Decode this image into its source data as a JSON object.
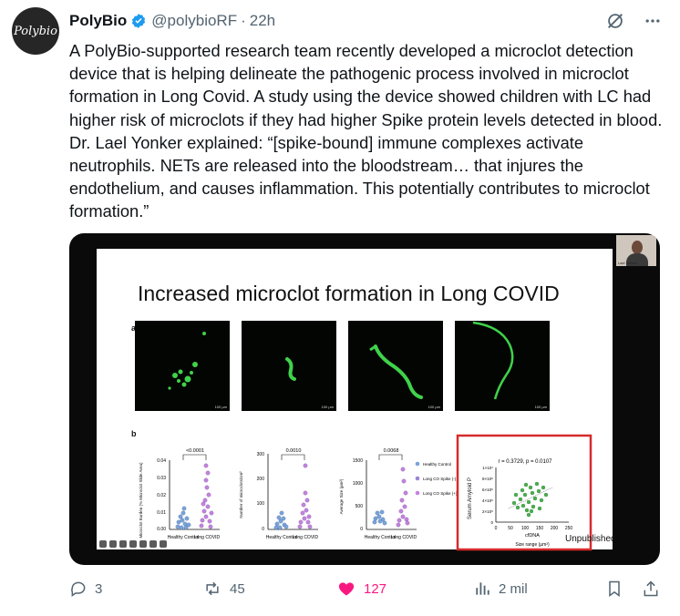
{
  "author": {
    "avatar_text": "Polybio",
    "name": "PolyBio",
    "handle": "@polybioRF",
    "separator": "·",
    "time": "22h"
  },
  "tweet": {
    "text": "A PolyBio-supported research team recently developed a microclot detection device that is helping delineate the pathogenic process involved in microclot formation in Long Covid. A study using the device showed children with LC had higher risk of microclots if they had higher Spike protein levels detected in blood. Dr. Lael Yonker explained: “[spike-bound] immune complexes activate neutrophils. NETs are released into the bloodstream… that injures the endothelium, and causes inflammation. This potentially contributes to microclot formation.”"
  },
  "media": {
    "slide_title": "Increased microclot formation in Long COVID",
    "panel_a": "a",
    "panel_b": "b",
    "scale_bar": "100 µm",
    "unpublished": "Unpublished",
    "presenter_caption": "Lael Yonker",
    "plots": [
      {
        "ylabel": "Microclot Burden (% Microclot Slide Area)",
        "yticks": [
          "0.04",
          "0.03",
          "0.02",
          "0.01",
          "0.00"
        ],
        "pvalue": "<0.0001",
        "x1": "Healthy Control",
        "x2": "Long COVID"
      },
      {
        "ylabel": "Number of microclots/cm²",
        "yticks": [
          "300",
          "200",
          "100",
          "0"
        ],
        "pvalue": "0.0010",
        "x1": "Healthy Control",
        "x2": "Long COVID"
      },
      {
        "ylabel": "Average Size (µm²)",
        "yticks": [
          "1500",
          "1000",
          "500",
          "0"
        ],
        "pvalue": "0.0068",
        "x1": "Healthy Control",
        "x2": "Long COVID"
      }
    ],
    "legend": [
      "Healthy Control",
      "Long CO Spike (-)",
      "Long CO Spike (+)"
    ],
    "scatter": {
      "title": "r = 0.3729, p = 0.0107",
      "ylabel": "Serum Amyloid P",
      "yticks": [
        "1×10⁷",
        "8×10⁶",
        "6×10⁶",
        "4×10⁶",
        "2×10⁶",
        "0"
      ],
      "xticks": [
        "0",
        "50",
        "100",
        "150",
        "200",
        "250"
      ],
      "xlabel": "cfDNA",
      "xlabel2": "Size range (µm²)"
    }
  },
  "actions": {
    "replies": "3",
    "reposts": "45",
    "likes": "127",
    "views": "2 mil"
  },
  "colors": {
    "like": "#f91880",
    "verified": "#1d9bf0",
    "muted": "#536471",
    "highlight_box": "#d62b2b"
  }
}
